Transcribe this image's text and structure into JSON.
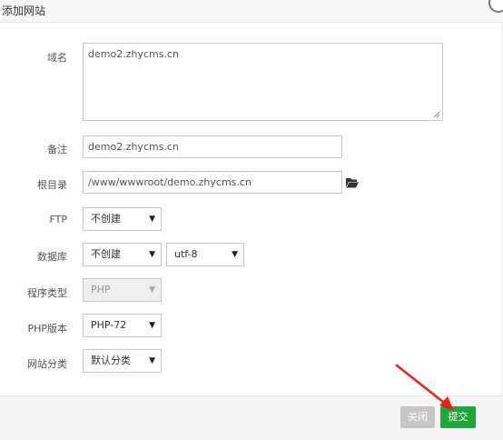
{
  "dialog": {
    "title": "添加网站"
  },
  "form": {
    "domain": {
      "label": "域名",
      "value": "demo2.zhycms.cn"
    },
    "remark": {
      "label": "备注",
      "value": "demo2.zhycms.cn"
    },
    "root": {
      "label": "根目录",
      "value": "/www/wwwroot/demo.zhycms.cn"
    },
    "ftp": {
      "label": "FTP",
      "selected": "不创建"
    },
    "database": {
      "label": "数据库",
      "selected": "不创建",
      "charset": "utf-8"
    },
    "program_type": {
      "label": "程序类型",
      "selected": "PHP"
    },
    "php_version": {
      "label": "PHP版本",
      "selected": "PHP-72"
    },
    "category": {
      "label": "网站分类",
      "selected": "默认分类"
    }
  },
  "footer": {
    "close_label": "关闭",
    "submit_label": "提交"
  },
  "colors": {
    "submit": "#20a53a",
    "close": "#c7c7c7",
    "arrow": "#e8211f"
  },
  "icons": {
    "folder": "folder-open-icon",
    "caret": "caret-down-icon"
  }
}
